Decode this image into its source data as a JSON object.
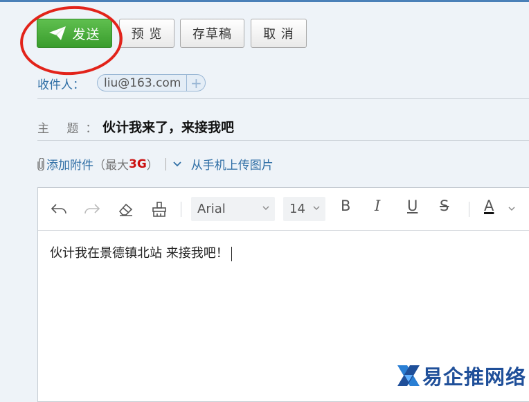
{
  "toolbar": {
    "send_label": "发送",
    "preview_label": "预 览",
    "draft_label": "存草稿",
    "cancel_label": "取 消"
  },
  "recipient": {
    "label": "收件人：",
    "address": "liu@163.com",
    "add_symbol": "+"
  },
  "subject": {
    "label": "主 题",
    "colon": "：",
    "value": "伙计我来了，来接我吧"
  },
  "attachment": {
    "link_label": "添加附件",
    "note_open": "（最大",
    "limit": "3G",
    "note_close": "）",
    "phone_upload_label": "从手机上传图片"
  },
  "editor": {
    "font_family": "Arial",
    "font_size": "14",
    "bold_label": "B",
    "italic_label": "I",
    "underline_label": "U",
    "strike_label": "S",
    "color_label": "A",
    "body": "伙计我在景德镇北站 来接我吧！"
  },
  "watermark": {
    "text": "易企推网络"
  },
  "colors": {
    "send_green": "#3a9d2d",
    "highlight_red": "#e2231a",
    "link_blue": "#2e6ea5",
    "limit_red": "#cc1111"
  }
}
